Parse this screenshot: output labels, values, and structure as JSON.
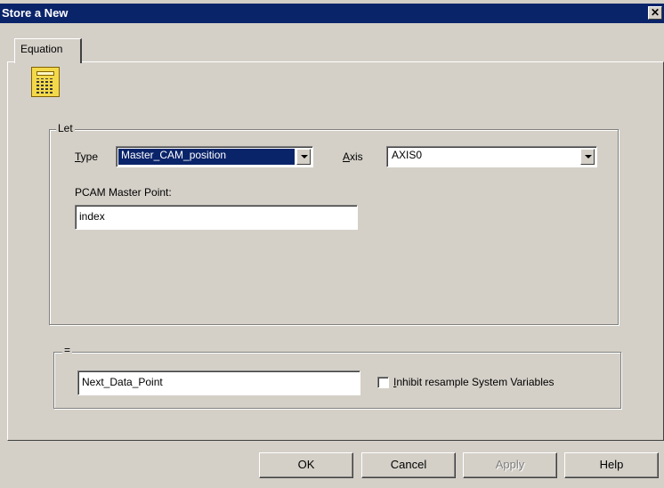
{
  "window": {
    "title": "Store a New",
    "close_glyph": "✕"
  },
  "tabs": [
    {
      "label": "Equation"
    }
  ],
  "icon": "calculator-icon",
  "let_group": {
    "label": "Let",
    "type_label_prefix": "T",
    "type_label_rest": "ype",
    "type_value": "Master_CAM_position",
    "axis_label_prefix": "A",
    "axis_label_rest": "xis",
    "axis_value": "AXIS0",
    "pcam_label": "PCAM Master Point:",
    "pcam_value": "index"
  },
  "equals_group": {
    "label": "=",
    "value": "Next_Data_Point",
    "inhibit_label_prefix": "I",
    "inhibit_label_rest": "nhibit resample System Variables",
    "inhibit_checked": false
  },
  "buttons": {
    "ok": "OK",
    "cancel": "Cancel",
    "apply": "Apply",
    "help": "Help"
  },
  "colors": {
    "titlebar": "#0a246a",
    "face": "#d4d0c8",
    "selection": "#0a246a",
    "icon_fill": "#f3d94a"
  }
}
